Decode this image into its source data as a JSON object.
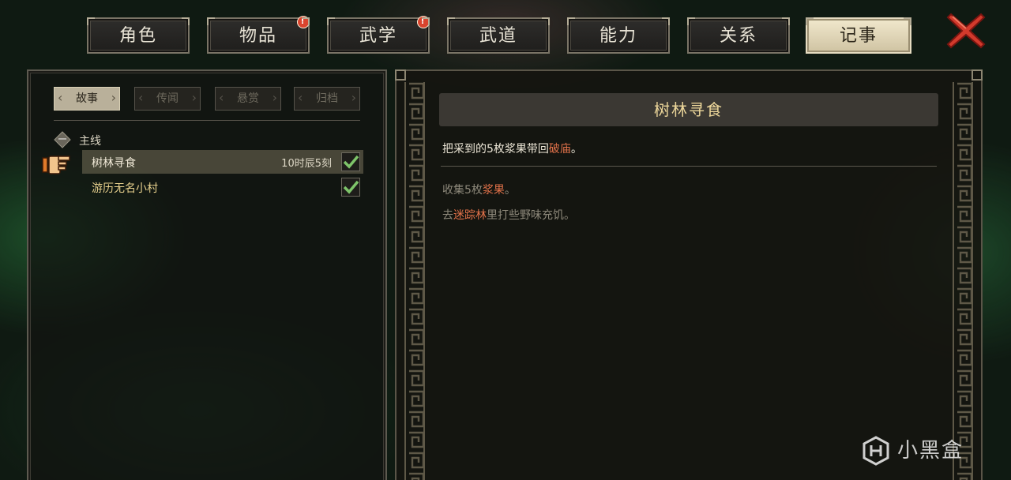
{
  "tabs": [
    {
      "label": "角色",
      "badge": false,
      "active": false
    },
    {
      "label": "物品",
      "badge": true,
      "active": false
    },
    {
      "label": "武学",
      "badge": true,
      "active": false
    },
    {
      "label": "武道",
      "badge": false,
      "active": false
    },
    {
      "label": "能力",
      "badge": false,
      "active": false
    },
    {
      "label": "关系",
      "badge": false,
      "active": false
    },
    {
      "label": "记事",
      "badge": false,
      "active": true
    }
  ],
  "badge_mark": "!",
  "close_icon": "close-x-icon",
  "subtabs": [
    {
      "label": "故事",
      "active": true
    },
    {
      "label": "传闻",
      "active": false
    },
    {
      "label": "悬赏",
      "active": false
    },
    {
      "label": "归档",
      "active": false
    }
  ],
  "quest_group": {
    "collapse_symbol": "一",
    "label": "主线"
  },
  "quests": [
    {
      "title": "树林寻食",
      "time": "10时辰5刻",
      "completed": true,
      "selected": true
    },
    {
      "title": "游历无名小村",
      "time": "",
      "completed": true,
      "selected": false
    }
  ],
  "detail": {
    "title": "树林寻食",
    "desc_before": "把采到的5枚浆果带回",
    "desc_highlight": "破庙",
    "desc_after": "。",
    "objectives": [
      {
        "before": "收集5枚",
        "highlight": "浆果",
        "after": "。"
      },
      {
        "before": "去",
        "highlight": "迷踪林",
        "after": "里打些野味充饥。"
      }
    ]
  },
  "watermark": {
    "text": "小黑盒"
  },
  "colors": {
    "accent_gold": "#ecd69a",
    "highlight_orange": "#e2724a",
    "check_green": "#7ec46a",
    "badge_red": "#d9442e"
  }
}
